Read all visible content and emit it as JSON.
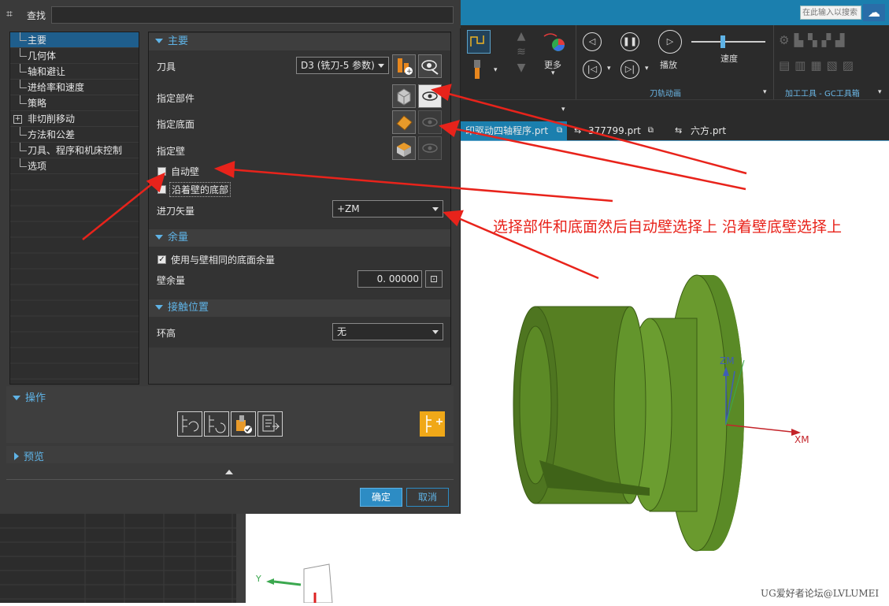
{
  "app": {
    "search_placeholder": "在此输入以搜索",
    "ribbon": {
      "more_label": "更多",
      "play_label": "播放",
      "speed_label": "速度",
      "group_animation": "刀轨动画",
      "group_gc": "加工工具 - GC工具箱"
    },
    "tabs": [
      {
        "label": "印驱动四轴程序.prt"
      },
      {
        "label": "377799.prt"
      },
      {
        "label": "六方.prt"
      }
    ],
    "axes": {
      "zm": "ZM",
      "xm": "XM",
      "y": "Y"
    }
  },
  "dialog": {
    "find_label": "查找",
    "tree": [
      {
        "label": "主要",
        "selected": true
      },
      {
        "label": "几何体"
      },
      {
        "label": "轴和避让"
      },
      {
        "label": "进给率和速度"
      },
      {
        "label": "策略"
      },
      {
        "label": "非切削移动",
        "expandable": true
      },
      {
        "label": "方法和公差"
      },
      {
        "label": "刀具、程序和机床控制"
      },
      {
        "label": "选项"
      }
    ],
    "main": {
      "title": "主要",
      "tool_label": "刀具",
      "tool_value": "D3 (铣刀-5 参数)",
      "part_label": "指定部件",
      "floor_label": "指定底面",
      "wall_label": "指定壁",
      "auto_wall_label": "自动壁",
      "along_wall_label": "沿着壁的底部",
      "feed_vector_label": "进刀矢量",
      "feed_vector_value": "+ZM"
    },
    "stock": {
      "title": "余量",
      "same_floor_label": "使用与壁相同的底面余量",
      "wall_stock_label": "壁余量",
      "wall_stock_value": "0. 00000"
    },
    "contact": {
      "title": "接触位置",
      "ring_label": "环高",
      "ring_value": "无"
    },
    "operations_title": "操作",
    "preview_title": "预览",
    "ok_label": "确定",
    "cancel_label": "取消"
  },
  "annotation": "选择部件和底面然后自动壁选择上 沿着壁底壁选择上",
  "watermark": "UG爱好者论坛@LVLUMEI",
  "colors": {
    "accent": "#5fb3e6",
    "selected": "#1f5e8c",
    "arrow": "#e8231b",
    "model": "#4f7a1f",
    "title_bar": "#1b7fae"
  }
}
